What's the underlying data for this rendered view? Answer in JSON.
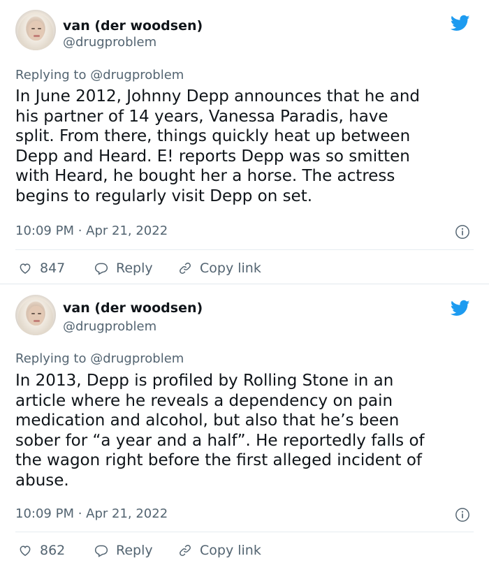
{
  "tweets": [
    {
      "display_name": "van (der woodsen)",
      "handle": "@drugproblem",
      "replying_to": "Replying to @drugproblem",
      "text": "In June 2012, Johnny Depp announces that he and\nhis partner of 14 years, Vanessa Paradis, have\nsplit. From there, things quickly heat up between\nDepp and Heard. E! reports Depp was so smitten\nwith Heard, he bought her a horse. The actress\nbegins to regularly visit Depp on set.",
      "timestamp": "10:09 PM · Apr 21, 2022",
      "likes": "847",
      "reply_label": "Reply",
      "copy_link_label": "Copy link"
    },
    {
      "display_name": "van (der woodsen)",
      "handle": "@drugproblem",
      "replying_to": "Replying to @drugproblem",
      "text": "In 2013, Depp is profiled by Rolling Stone in an\narticle where he reveals a dependency on pain\nmedication and alcohol, but also that he’s been\nsober for “a year and a half”. He reportedly falls of\nthe wagon right before the first alleged incident of\nabuse.",
      "timestamp": "10:09 PM · Apr 21, 2022",
      "likes": "862",
      "reply_label": "Reply",
      "copy_link_label": "Copy link"
    }
  ],
  "icons": {
    "brand": "twitter-bird-icon",
    "info": "info-icon",
    "like": "heart-icon",
    "reply": "reply-icon",
    "copy": "link-icon"
  },
  "colors": {
    "twitter_blue": "#1d9bf0",
    "text_primary": "#0f1419",
    "text_secondary": "#536471",
    "divider": "#e6ecf0"
  }
}
